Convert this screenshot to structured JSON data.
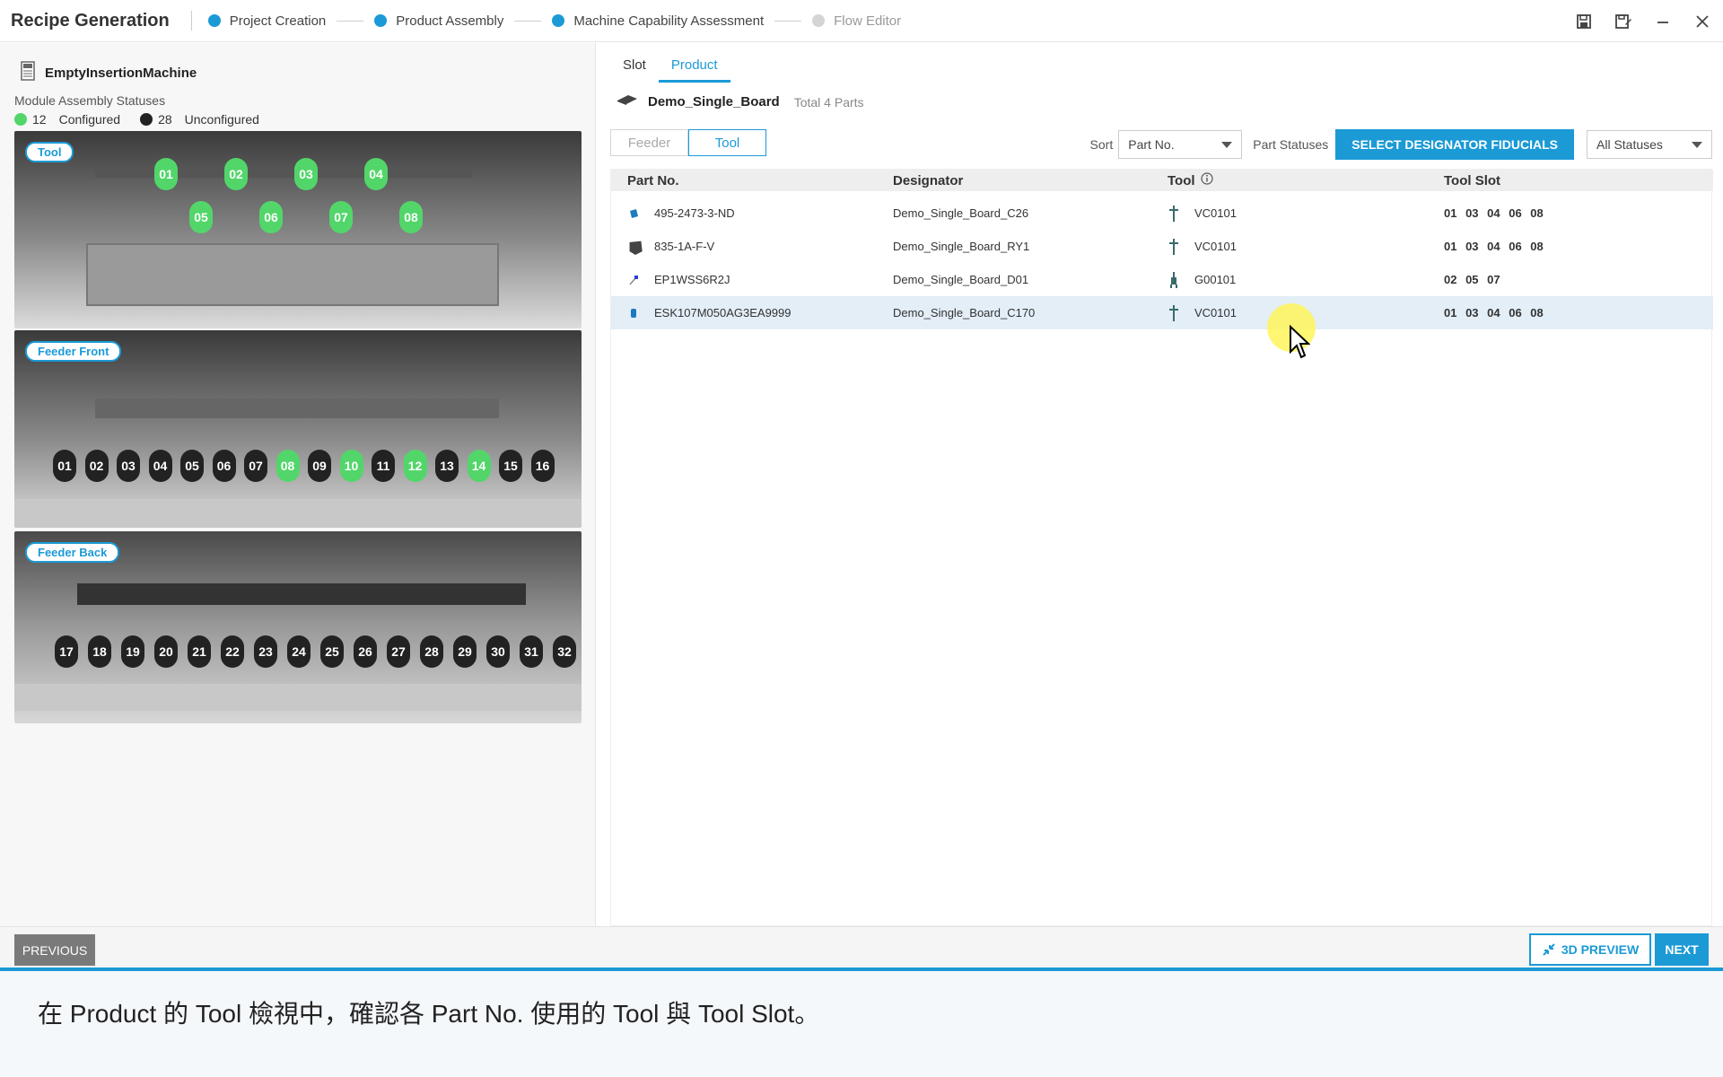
{
  "app_title": "Recipe Generation",
  "steps": [
    {
      "label": "Project Creation",
      "state": "done"
    },
    {
      "label": "Product Assembly",
      "state": "done"
    },
    {
      "label": "Machine Capability Assessment",
      "state": "done"
    },
    {
      "label": "Flow Editor",
      "state": "pending"
    }
  ],
  "machine_name": "EmptyInsertionMachine",
  "status_title": "Module Assembly Statuses",
  "configured_count": "12",
  "configured_label": "Configured",
  "unconfigured_count": "28",
  "unconfigured_label": "Unconfigured",
  "sections": {
    "tool": "Tool",
    "feeder_front": "Feeder Front",
    "feeder_back": "Feeder Back"
  },
  "tool_slots": [
    {
      "n": "01",
      "on": true
    },
    {
      "n": "02",
      "on": true
    },
    {
      "n": "03",
      "on": true
    },
    {
      "n": "04",
      "on": true
    },
    {
      "n": "05",
      "on": true
    },
    {
      "n": "06",
      "on": true
    },
    {
      "n": "07",
      "on": true
    },
    {
      "n": "08",
      "on": true
    }
  ],
  "feeder_front_slots": [
    {
      "n": "01",
      "on": false
    },
    {
      "n": "02",
      "on": false
    },
    {
      "n": "03",
      "on": false
    },
    {
      "n": "04",
      "on": false
    },
    {
      "n": "05",
      "on": false
    },
    {
      "n": "06",
      "on": false
    },
    {
      "n": "07",
      "on": false
    },
    {
      "n": "08",
      "on": true
    },
    {
      "n": "09",
      "on": false
    },
    {
      "n": "10",
      "on": true
    },
    {
      "n": "11",
      "on": false
    },
    {
      "n": "12",
      "on": true
    },
    {
      "n": "13",
      "on": false
    },
    {
      "n": "14",
      "on": true
    },
    {
      "n": "15",
      "on": false
    },
    {
      "n": "16",
      "on": false
    }
  ],
  "feeder_back_slots": [
    {
      "n": "17"
    },
    {
      "n": "18"
    },
    {
      "n": "19"
    },
    {
      "n": "20"
    },
    {
      "n": "21"
    },
    {
      "n": "22"
    },
    {
      "n": "23"
    },
    {
      "n": "24"
    },
    {
      "n": "25"
    },
    {
      "n": "26"
    },
    {
      "n": "27"
    },
    {
      "n": "28"
    },
    {
      "n": "29"
    },
    {
      "n": "30"
    },
    {
      "n": "31"
    },
    {
      "n": "32"
    }
  ],
  "tabs": [
    {
      "label": "Slot",
      "active": false
    },
    {
      "label": "Product",
      "active": true
    }
  ],
  "board": {
    "name": "Demo_Single_Board",
    "total": "Total 4 Parts"
  },
  "view_toggle": [
    {
      "label": "Feeder",
      "active": false
    },
    {
      "label": "Tool",
      "active": true
    }
  ],
  "sort_label": "Sort",
  "sort_value": "Part No.",
  "part_statuses_label": "Part Statuses",
  "fiducials_button": "SELECT DESIGNATOR  FIDUCIALS",
  "status_filter": "All Statuses",
  "table": {
    "headers": [
      "Part No.",
      "Designator",
      "Tool",
      "Tool Slot"
    ],
    "rows": [
      {
        "part": "495-2473-3-ND",
        "designator": "Demo_Single_Board_C26",
        "tool": "VC0101",
        "slots": "01 03 04 06 08",
        "icon": "capacitor-icon",
        "tool_icon": "vacuum-nozzle-icon"
      },
      {
        "part": "835-1A-F-V",
        "designator": "Demo_Single_Board_RY1",
        "tool": "VC0101",
        "slots": "01 03 04 06 08",
        "icon": "relay-icon",
        "tool_icon": "vacuum-nozzle-icon"
      },
      {
        "part": "EP1WSS6R2J",
        "designator": "Demo_Single_Board_D01",
        "tool": "G00101",
        "slots": "02 05 07",
        "icon": "diode-icon",
        "tool_icon": "gripper-icon"
      },
      {
        "part": "ESK107M050AG3EA9999",
        "designator": "Demo_Single_Board_C170",
        "tool": "VC0101",
        "slots": "01 03 04 06 08",
        "icon": "capacitor-icon",
        "tool_icon": "vacuum-nozzle-icon",
        "selected": true
      }
    ]
  },
  "buttons": {
    "previous": "PREVIOUS",
    "preview": "3D PREVIEW",
    "next": "NEXT"
  },
  "caption": "在 Product 的 Tool 檢視中，確認各 Part No. 使用的 Tool 與 Tool Slot。",
  "colors": {
    "accent": "#1b9ad6",
    "configured": "#52d66a",
    "unconfigured": "#222222",
    "selected_row": "#e3eef7"
  }
}
